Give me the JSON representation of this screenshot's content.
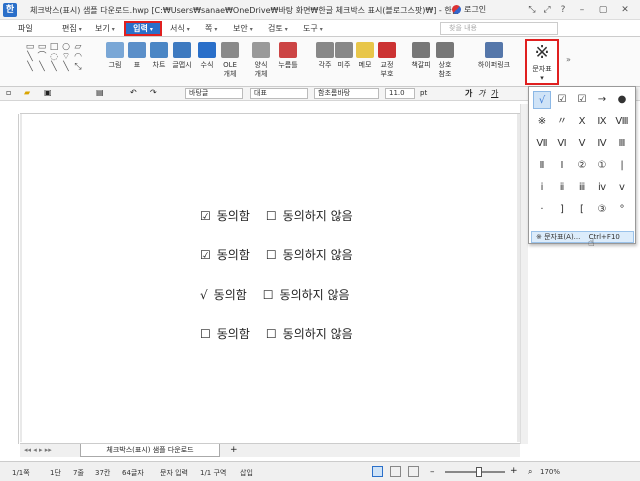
{
  "window": {
    "title": "체크박스(표시) 샘플 다운로드.hwp [C:₩Users₩sanae₩OneDrive₩바탕 화면₩한글 체크박스 표시(블로그스팟)₩] - 한글",
    "login": "로그인",
    "controls": [
      "⤡",
      "⤢",
      "?",
      "–",
      "▢",
      "✕"
    ]
  },
  "menubar": {
    "items": [
      "파일",
      "편집",
      "보기",
      "입력",
      "서식",
      "쪽",
      "보안",
      "검토",
      "도구"
    ],
    "active": "입력",
    "search_placeholder": "찾을 내용"
  },
  "ribbon": {
    "buttons": [
      {
        "label": "그림",
        "color": "#7aa7d6"
      },
      {
        "label": "표",
        "color": "#5b8fc9"
      },
      {
        "label": "차트",
        "color": "#4a86c5"
      },
      {
        "label": "글맵시",
        "color": "#3e7ac0"
      },
      {
        "label": "수식",
        "color": "#2a6fc9"
      },
      {
        "label": "OLE\n개체",
        "color": "#8a8a8a"
      },
      {
        "label": "양식\n개체",
        "color": "#999"
      },
      {
        "label": "누름틀",
        "color": "#c44"
      },
      {
        "label": "각주",
        "color": "#888"
      },
      {
        "label": "미주",
        "color": "#888"
      },
      {
        "label": "메모",
        "color": "#e8c64a"
      },
      {
        "label": "교정\n부호",
        "color": "#c33"
      },
      {
        "label": "책갈피",
        "color": "#777"
      },
      {
        "label": "상호\n참조",
        "color": "#777"
      },
      {
        "label": "하이퍼링크",
        "color": "#5577aa"
      }
    ],
    "char_button": {
      "symbol": "※",
      "label": "문자표"
    }
  },
  "format_bar": {
    "style": "바탕글",
    "lang": "대표",
    "font": "함초롬바탕",
    "size": "11.0",
    "unit": "pt",
    "bold": "가",
    "italic": "가",
    "underline": "가"
  },
  "document": {
    "rows": [
      {
        "mark": "☑",
        "agree": "동의함",
        "disagree_mark": "☐",
        "disagree": "동의하지 않음",
        "boxed": false
      },
      {
        "mark": "☑",
        "agree": "동의함",
        "disagree_mark": "☐",
        "disagree": "동의하지 않음",
        "boxed": false
      },
      {
        "mark": "√",
        "agree": "동의함",
        "disagree_mark": "☐",
        "disagree": "동의하지 않음",
        "boxed": false
      },
      {
        "mark": "☐",
        "agree": "동의함",
        "disagree_mark": "☐",
        "disagree": "동의하지 않음",
        "boxed": false
      }
    ]
  },
  "popup": {
    "grid": [
      [
        "√",
        "☑",
        "☑",
        "→",
        "●"
      ],
      [
        "※",
        "〃",
        "Ⅹ",
        "Ⅸ",
        "Ⅷ"
      ],
      [
        "Ⅶ",
        "Ⅵ",
        "Ⅴ",
        "Ⅳ",
        "Ⅲ"
      ],
      [
        "Ⅱ",
        "Ⅰ",
        "②",
        "①",
        "|"
      ],
      [
        "ⅰ",
        "ⅱ",
        "ⅲ",
        "ⅳ",
        "ⅴ"
      ],
      [
        "·",
        "]",
        "[",
        "③",
        "°"
      ]
    ],
    "footer_symbol": "※",
    "footer_label": "문자표(A)...",
    "footer_shortcut": "Ctrl+F10"
  },
  "tabs": {
    "doc_tab": "체크박스(표시) 샘플 다운로드",
    "add": "+"
  },
  "status": {
    "page": "1/1쪽",
    "section": "1단",
    "line": "7줄",
    "col": "37칸",
    "chars": "64글자",
    "mode": "문자 입력",
    "area": "1/1 구역",
    "insert": "삽입",
    "zoom": "170%"
  }
}
